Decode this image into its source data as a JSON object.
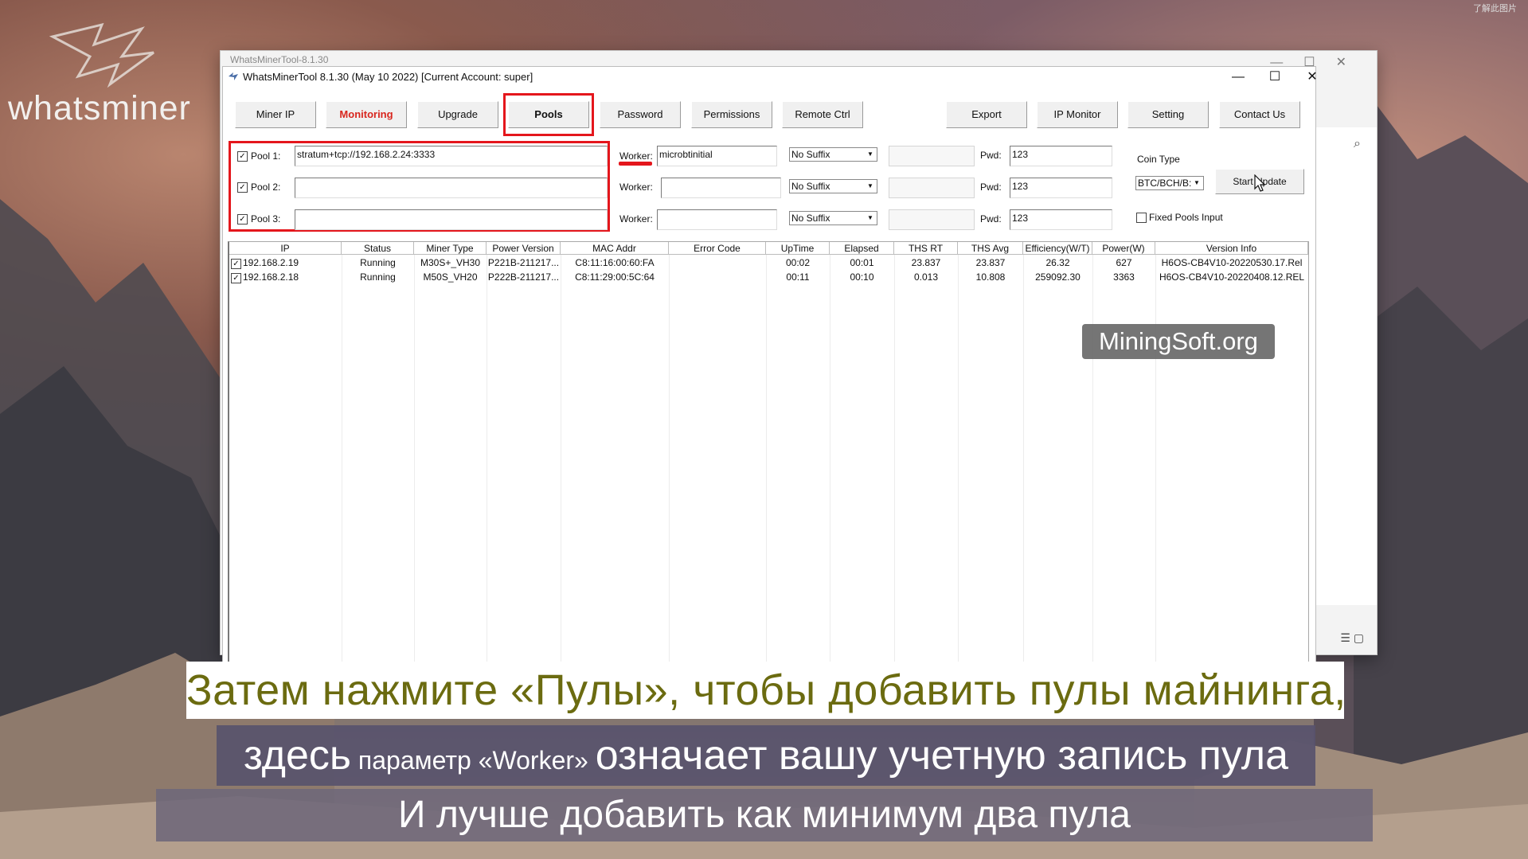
{
  "brand": {
    "logo_text": "whatsminer"
  },
  "corner_text": "了解此图片",
  "back_window": {
    "title": "WhatsMinerTool-8.1.30"
  },
  "window": {
    "title": "WhatsMinerTool 8.1.30 (May 10 2022) [Current Account: super]",
    "controls": {
      "minimize": "—",
      "maximize": "☐",
      "close": "✕"
    }
  },
  "tabs": {
    "miner_ip": "Miner IP",
    "monitoring": "Monitoring",
    "upgrade": "Upgrade",
    "pools": "Pools",
    "password": "Password",
    "permissions": "Permissions",
    "remote_ctrl": "Remote Ctrl",
    "export": "Export",
    "ip_monitor": "IP Monitor",
    "setting": "Setting",
    "contact_us": "Contact Us"
  },
  "pools": [
    {
      "label": "Pool 1:",
      "checked": true,
      "url": "stratum+tcp://192.168.2.24:3333",
      "worker_label": "Worker:",
      "worker": "microbtinitial",
      "suffix": "No Suffix",
      "pwd_label": "Pwd:",
      "pwd": "123"
    },
    {
      "label": "Pool 2:",
      "checked": true,
      "url": "",
      "worker_label": "Worker:",
      "worker": "",
      "suffix": "No Suffix",
      "pwd_label": "Pwd:",
      "pwd": "123"
    },
    {
      "label": "Pool 3:",
      "checked": true,
      "url": "",
      "worker_label": "Worker:",
      "worker": "",
      "suffix": "No Suffix",
      "pwd_label": "Pwd:",
      "pwd": "123"
    }
  ],
  "coin": {
    "label": "Coin Type",
    "value": "BTC/BCH/B:",
    "start_update": "Start Update",
    "fixed_pools": "Fixed Pools Input",
    "fixed_checked": false
  },
  "table": {
    "headers": [
      "IP",
      "Status",
      "Miner Type",
      "Power Version",
      "MAC Addr",
      "Error Code",
      "UpTime",
      "Elapsed",
      "THS RT",
      "THS Avg",
      "Efficiency(W/T)",
      "Power(W)",
      "Version Info"
    ],
    "rows": [
      [
        "192.168.2.19",
        "Running",
        "M30S+_VH30",
        "P221B-211217...",
        "C8:11:16:00:60:FA",
        "",
        "00:02",
        "00:01",
        "23.837",
        "23.837",
        "26.32",
        "627",
        "H6OS-CB4V10-20220530.17.Rel"
      ],
      [
        "192.168.2.18",
        "Running",
        "M50S_VH20",
        "P222B-211217...",
        "C8:11:29:00:5C:64",
        "",
        "00:11",
        "00:10",
        "0.013",
        "10.808",
        "259092.30",
        "3363",
        "H6OS-CB4V10-20220408.12.REL"
      ]
    ]
  },
  "watermark": "MiningSoft.org",
  "subtitles": {
    "line1": "Затем нажмите «Пулы», чтобы добавить пулы майнинга,",
    "line2_a": "здесь",
    "line2_b": " параметр «Worker» ",
    "line2_c": "означает вашу учетную запись пула",
    "line3": "И лучше добавить как минимум два пула"
  },
  "colors": {
    "highlight": "#e4161c",
    "monitoring_tab": "#d8261e",
    "subtitle_yellow": "#6b6b10"
  }
}
